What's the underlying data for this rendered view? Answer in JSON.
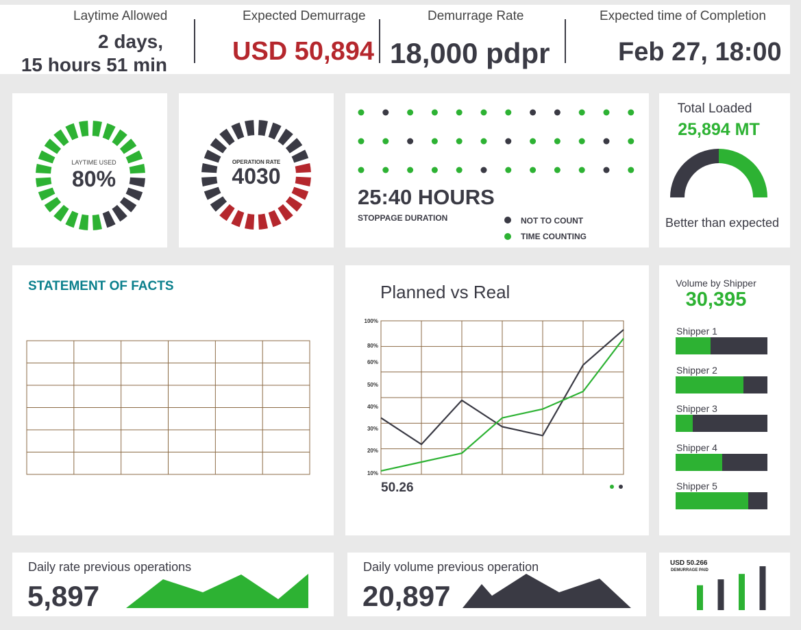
{
  "colors": {
    "green": "#2db233",
    "dark": "#3a3a44",
    "red": "#b5272d",
    "teal": "#0a7f8c",
    "grid": "#8b6a44",
    "background": "#e9e9e9"
  },
  "header": {
    "laytime": {
      "label": "Laytime Allowed",
      "value_line1": "2 days,",
      "value_line2": "15 hours 51 min"
    },
    "demurrage": {
      "label": "Expected Demurrage",
      "value": "USD 50,894"
    },
    "rate": {
      "label": "Demurrage Rate",
      "value": "18,000 pdpr"
    },
    "completion": {
      "label": "Expected time of Completion",
      "value": "Feb 27, 18:00"
    }
  },
  "laytime_used": {
    "label": "LAYTIME USED",
    "value": "80%",
    "percent": 80
  },
  "operation_rate": {
    "label": "OPERATION RATE",
    "value": "4030",
    "segments": [
      "dark",
      "dark",
      "dark",
      "dark",
      "dark",
      "red",
      "red",
      "red",
      "red",
      "red",
      "red",
      "red",
      "red",
      "red",
      "red",
      "dark",
      "dark",
      "dark",
      "dark",
      "dark",
      "dark",
      "dark",
      "dark",
      "dark"
    ]
  },
  "stoppage": {
    "value": "25:40 HOURS",
    "label": "STOPPAGE DURATION",
    "legend_not_count": "NOT TO COUNT",
    "legend_counting": "TIME COUNTING",
    "dot_rows": [
      [
        "g",
        "d",
        "g",
        "g",
        "g",
        "g",
        "g",
        "d",
        "d",
        "g",
        "g",
        "g"
      ],
      [
        "g",
        "g",
        "d",
        "g",
        "g",
        "g",
        "d",
        "g",
        "g",
        "g",
        "d",
        "g"
      ],
      [
        "g",
        "g",
        "g",
        "g",
        "g",
        "d",
        "g",
        "g",
        "g",
        "g",
        "d",
        "g"
      ]
    ]
  },
  "total_loaded": {
    "label": "Total Loaded",
    "value": "25,894 MT",
    "caption": "Better than expected",
    "fraction": 0.5
  },
  "statement": {
    "title": "STATEMENT OF FACTS",
    "rows": 6,
    "cols": 6
  },
  "planned_vs_real": {
    "title": "Planned vs Real",
    "footer_value": "50.26",
    "y_ticks": [
      "100%",
      "80%",
      "60%",
      "50%",
      "40%",
      "30%",
      "20%",
      "10%"
    ]
  },
  "chart_data": {
    "type": "line",
    "title": "Planned vs Real",
    "x": [
      0,
      1,
      2,
      3,
      4,
      5,
      6
    ],
    "y_ticks": [
      "10%",
      "20%",
      "30%",
      "40%",
      "50%",
      "60%",
      "80%",
      "100%"
    ],
    "grid": true,
    "series": [
      {
        "color": "#3a3a44",
        "values": [
          40,
          25,
          50,
          35,
          30,
          70,
          90
        ]
      },
      {
        "color": "#2db233",
        "values": [
          10,
          15,
          20,
          40,
          45,
          55,
          85
        ]
      }
    ]
  },
  "shippers": {
    "title": "Volume by Shipper",
    "total": "30,395",
    "items": [
      {
        "label": "Shipper 1",
        "fraction": 0.38
      },
      {
        "label": "Shipper 2",
        "fraction": 0.74
      },
      {
        "label": "Shipper 3",
        "fraction": 0.19
      },
      {
        "label": "Shipper 4",
        "fraction": 0.51
      },
      {
        "label": "Shipper 5",
        "fraction": 0.79
      }
    ]
  },
  "daily_rate": {
    "label": "Daily rate previous operations",
    "value": "5,897"
  },
  "daily_volume": {
    "label": "Daily volume previous operation",
    "value": "20,897"
  },
  "demurrage_paid": {
    "amount": "USD 50.266",
    "label": "DEMURRAGE PAID",
    "bars": [
      0.55,
      0.68,
      0.8,
      0.97
    ]
  }
}
